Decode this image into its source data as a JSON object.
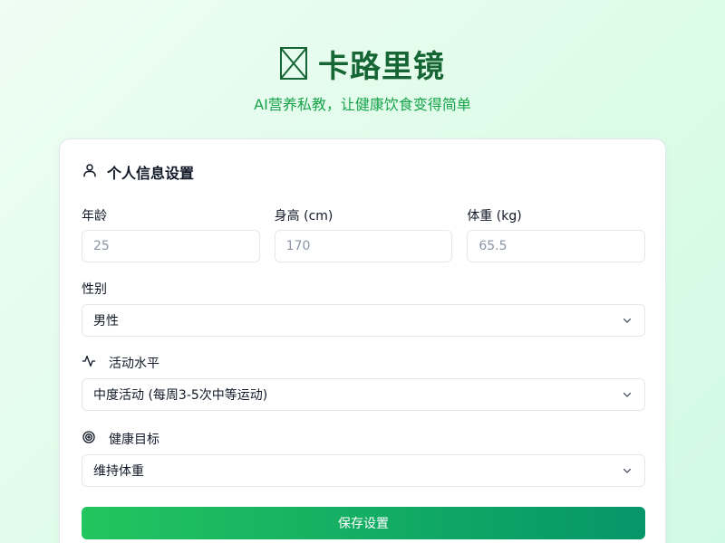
{
  "header": {
    "title": "卡路里镜",
    "subtitle": "AI营养私教，让健康饮食变得简单"
  },
  "profile_card": {
    "title": "个人信息设置",
    "age": {
      "label": "年龄",
      "placeholder": "25"
    },
    "height": {
      "label": "身高 (cm)",
      "placeholder": "170"
    },
    "weight": {
      "label": "体重 (kg)",
      "placeholder": "65.5"
    },
    "gender": {
      "label": "性别",
      "value": "男性"
    },
    "activity": {
      "label": "活动水平",
      "value": "中度活动 (每周3-5次中等运动)"
    },
    "goal": {
      "label": "健康目标",
      "value": "维持体重"
    },
    "save_label": "保存设置"
  },
  "colors": {
    "brand": "#166534",
    "accent": "#16a34a",
    "button_start": "#22c55e",
    "button_end": "#059669"
  },
  "icons": {
    "logo": "missing-glyph-box",
    "card": "user-icon",
    "activity": "activity-pulse-icon",
    "goal": "target-icon",
    "select": "chevron-down-icon"
  }
}
